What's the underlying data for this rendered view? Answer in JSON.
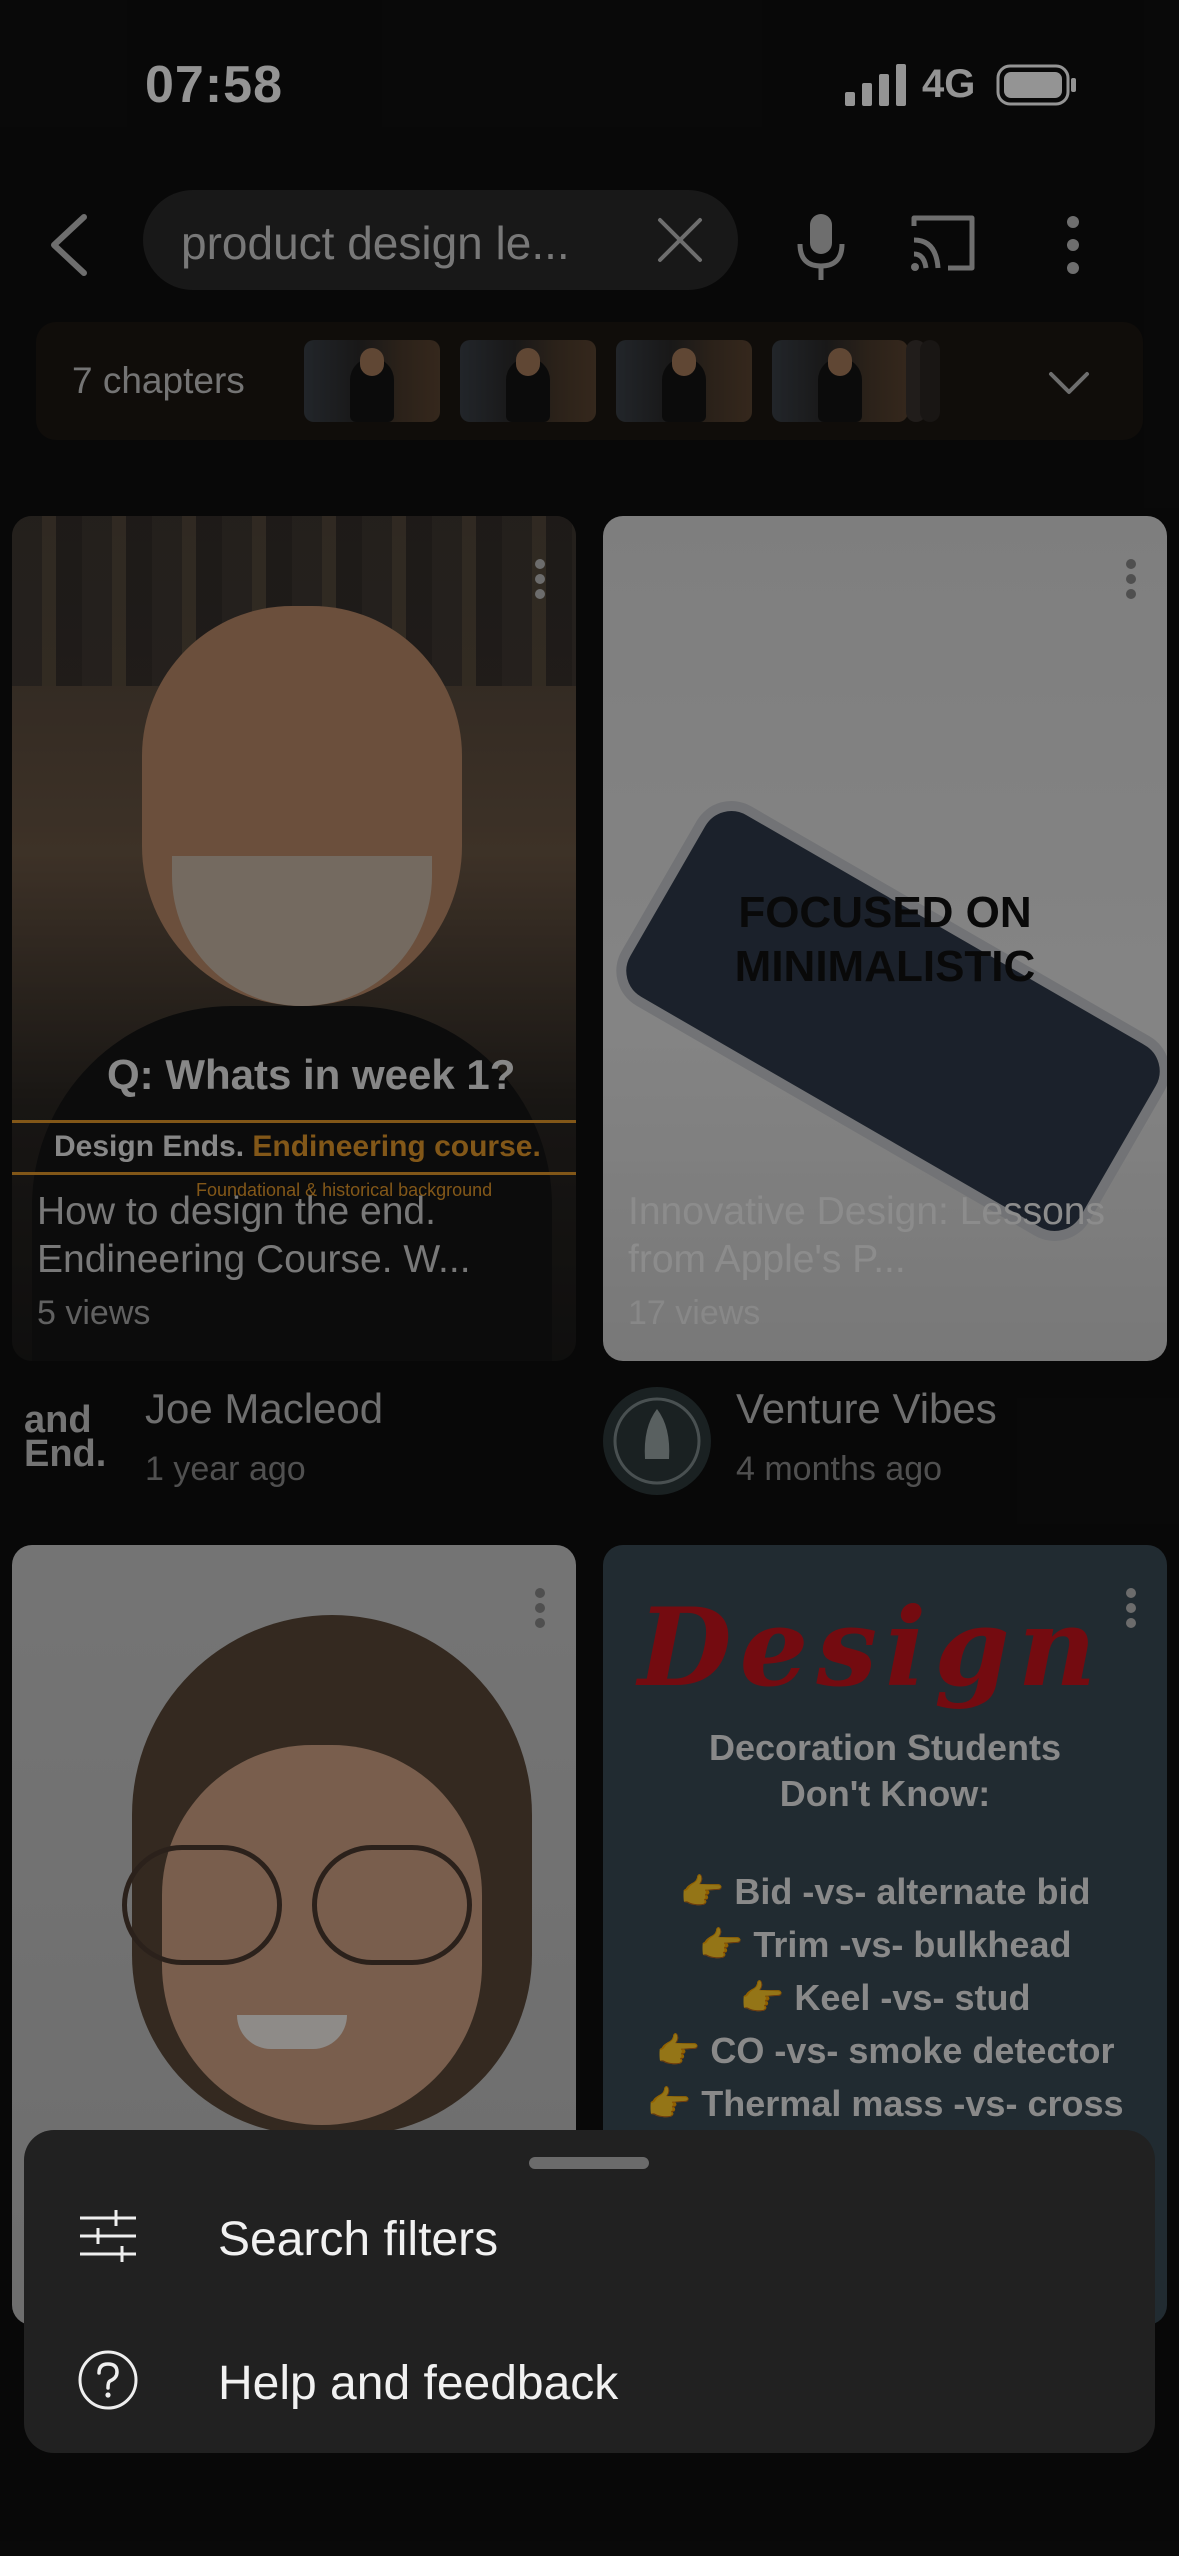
{
  "status_bar": {
    "time": "07:58",
    "network": "4G"
  },
  "search": {
    "query": "product design le..."
  },
  "chapters": {
    "label": "7 chapters"
  },
  "videos": [
    {
      "title": "How to design the end. Endineering Course. W...",
      "views": "5 views",
      "channel": "Joe Macleod",
      "age": "1 year ago",
      "thumb_heading": "Q: Whats in week 1?",
      "thumb_line_white": "Design Ends.",
      "thumb_line_orange": "Endineering course.",
      "thumb_sub": "Foundational & historical background",
      "avatar_text": "and End."
    },
    {
      "title": "Innovative Design: Lessons from Apple's P...",
      "views": "17 views",
      "channel": "Venture Vibes",
      "age": "4 months ago",
      "thumb_caption_1": "FOCUSED ON",
      "thumb_caption_2": "MINIMALISTIC"
    },
    {
      "title": "",
      "views": "",
      "channel": "",
      "age": ""
    },
    {
      "title": "",
      "views": "",
      "channel": "",
      "age": "",
      "thumb_script": "Design",
      "thumb_heading": "Decoration Students Don't Know:",
      "thumb_list": [
        "Bid -vs- alternate bid",
        "Trim -vs- bulkhead",
        "Keel -vs- stud",
        "CO -vs- smoke detector",
        "Thermal mass -vs- cross"
      ]
    }
  ],
  "sheet": {
    "items": [
      {
        "label": "Search filters",
        "icon": "sliders-icon"
      },
      {
        "label": "Help and feedback",
        "icon": "help-icon"
      }
    ]
  },
  "colors": {
    "background": "#0f0f0f",
    "sheet": "#212121",
    "accent_orange": "#e0962a",
    "script_red": "#c8141c"
  }
}
